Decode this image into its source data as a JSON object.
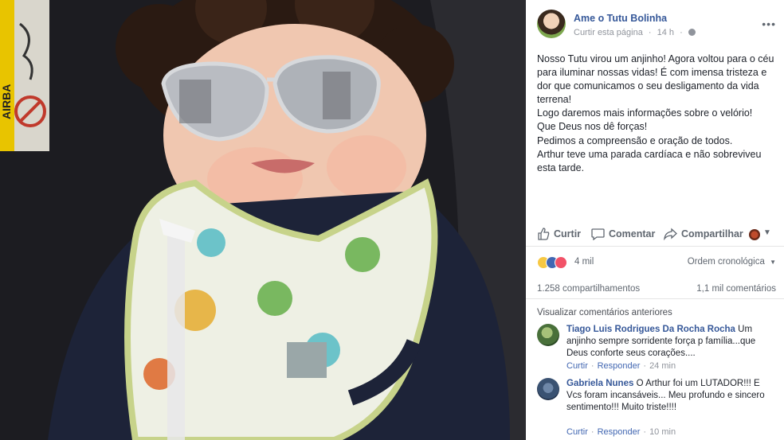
{
  "post": {
    "page_name": "Ame o Tutu Bolinha",
    "like_page": "Curtir esta página",
    "time": "14 h",
    "text_lines": [
      "Nosso Tutu virou um anjinho! Agora voltou para o céu para iluminar nossas vidas! É com imensa tristeza e dor que comunicamos o seu desligamento da vida terrena!",
      "Logo daremos mais informações sobre o velório!",
      "Que Deus nos dê forças!",
      "Pedimos a compreensão e oração de todos.",
      "Arthur teve uma parada cardíaca e não sobreviveu esta tarde."
    ]
  },
  "actions": {
    "like": "Curtir",
    "comment": "Comentar",
    "share": "Compartilhar"
  },
  "reactions": {
    "count": "4 mil",
    "order": "Ordem cronológica"
  },
  "stats": {
    "shares": "1.258 compartilhamentos",
    "comments": "1,1 mil comentários"
  },
  "view_previous": "Visualizar comentários anteriores",
  "comments": [
    {
      "author": "Tiago Luis Rodrigues Da Rocha Rocha",
      "text": "Um anjinho sempre sorridente força p família...que Deus conforte seus corações....",
      "like": "Curtir",
      "reply": "Responder",
      "time": "24 min"
    },
    {
      "author": "Gabriela Nunes",
      "text": "O Arthur foi um LUTADOR!!! E Vcs foram incansáveis... Meu profundo e sincero sentimento!!! Muito triste!!!!",
      "like": "Curtir",
      "reply": "Responder",
      "time": "10 min"
    }
  ],
  "photo_text": "AIRBA",
  "colors": {
    "link": "#365899",
    "meta": "#90949c",
    "action": "#606770"
  }
}
